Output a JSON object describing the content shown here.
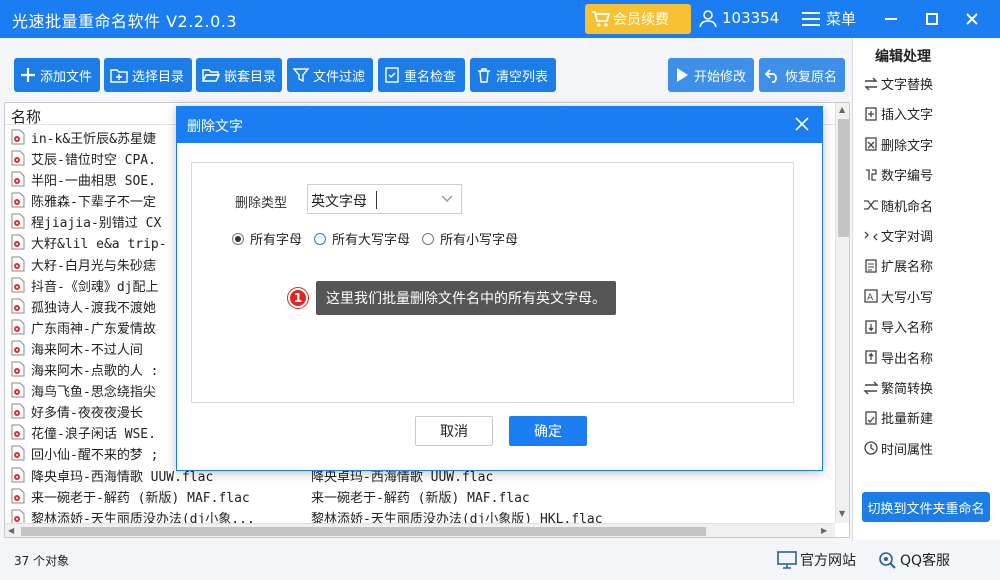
{
  "window": {
    "title": "光速批量重命名软件 V2.2.0.3",
    "vip_label": "会员续费",
    "user_id": "103354",
    "menu_label": "菜单"
  },
  "toolbar": {
    "add_file": "添加文件",
    "select_dir": "选择目录",
    "nested_dir": "嵌套目录",
    "file_filter": "文件过滤",
    "rename_check": "重名检查",
    "clear_list": "清空列表",
    "start_modify": "开始修改",
    "restore_name": "恢复原名"
  },
  "filelist": {
    "header_name": "名称",
    "rows": [
      {
        "name": "in-k&王忻辰&苏星婕",
        "new": ""
      },
      {
        "name": "艾辰-错位时空 CPA.",
        "new": ""
      },
      {
        "name": "半阳-一曲相思 SOE.",
        "new": ""
      },
      {
        "name": "陈雅森-下辈子不一定",
        "new": ""
      },
      {
        "name": "程jiajia-别错过 CX",
        "new": ""
      },
      {
        "name": "大籽&lil e&a trip-",
        "new": ""
      },
      {
        "name": "大籽-白月光与朱砂痣",
        "new": ""
      },
      {
        "name": "抖音-《剑魂》dj配上",
        "new": ""
      },
      {
        "name": "孤独诗人-渡我不渡她",
        "new": ""
      },
      {
        "name": "广东雨神-广东爱情故",
        "new": ""
      },
      {
        "name": "海来阿木-不过人间",
        "new": ""
      },
      {
        "name": "海来阿木-点歌的人 :",
        "new": ""
      },
      {
        "name": "海鸟飞鱼-思念绕指尖",
        "new": ""
      },
      {
        "name": "好多倩-夜夜夜漫长",
        "new": ""
      },
      {
        "name": "花僮-浪子闲话 WSE.",
        "new": ""
      },
      {
        "name": "回小仙-醒不来的梦 ;",
        "new": ""
      },
      {
        "name": "降央卓玛-西海情歌 UUW.flac",
        "new": "降央卓玛-西海情歌 UUW.flac"
      },
      {
        "name": "来一碗老于-解药 (新版) MAF.flac",
        "new": "来一碗老于-解药 (新版) MAF.flac"
      },
      {
        "name": "黎林添娇-天生丽质没办法(dj小象...",
        "new": "黎林添娇-天生丽质没办法(dj小象版) HKL.flac"
      }
    ]
  },
  "status": {
    "count": "37 个对象",
    "website": "官方网站",
    "qq": "QQ客服"
  },
  "panel": {
    "title": "编辑处理",
    "items": [
      "文字替换",
      "插入文字",
      "删除文字",
      "数字编号",
      "随机命名",
      "文字对调",
      "扩展名称",
      "大写小写",
      "导入名称",
      "导出名称",
      "繁简转换",
      "批量新建",
      "时间属性"
    ],
    "switch_label": "切换到文件夹重命名"
  },
  "dialog": {
    "title": "删除文字",
    "type_label": "删除类型",
    "type_value": "英文字母",
    "radios": [
      "所有字母",
      "所有大写字母",
      "所有小写字母"
    ],
    "tip_number": "1",
    "tip_text": "这里我们批量删除文件名中的所有英文字母。",
    "cancel": "取消",
    "ok": "确定"
  },
  "colors": {
    "brand_blue": "#1a7ef2",
    "vip_gold": "#f7c133",
    "tip_red": "#e02424"
  }
}
